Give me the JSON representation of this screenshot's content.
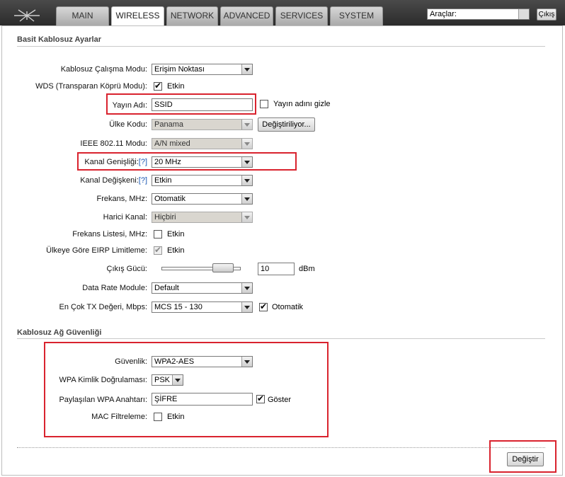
{
  "nav": {
    "tabs": [
      {
        "label": "MAIN"
      },
      {
        "label": "WIRELESS"
      },
      {
        "label": "NETWORK"
      },
      {
        "label": "ADVANCED"
      },
      {
        "label": "SERVICES"
      },
      {
        "label": "SYSTEM"
      }
    ],
    "active_tab": "WIRELESS",
    "tools_select": "Araçlar:",
    "logout_label": "Çıkış"
  },
  "basic": {
    "title": "Basit Kablosuz Ayarlar",
    "mode_label": "Kablosuz Çalışma Modu:",
    "mode_value": "Erişim Noktası",
    "wds_label": "WDS (Transparan Köprü Modu):",
    "wds_enabled": true,
    "wds_text": "Etkin",
    "ssid_label": "Yayın Adı:",
    "ssid_value": "SSID",
    "hide_ssid_text": "Yayın adını gizle",
    "hide_ssid": false,
    "country_label": "Ülke Kodu:",
    "country_value": "Panama",
    "country_button": "Değiştiriliyor...",
    "ieee_label": "IEEE 802.11 Modu:",
    "ieee_value": "A/N mixed",
    "width_label": "Kanal Genişliği:",
    "width_help": "[?]",
    "width_value": "20 MHz",
    "shift_label": "Kanal Değişkeni:",
    "shift_help": "[?]",
    "shift_value": "Etkin",
    "freq_label": "Frekans, MHz:",
    "freq_value": "Otomatik",
    "ext_label": "Harici Kanal:",
    "ext_value": "Hiçbiri",
    "freqlist_label": "Frekans Listesi, MHz:",
    "freqlist_text": "Etkin",
    "freqlist_enabled": false,
    "eirp_label": "Ülkeye Göre EIRP Limitleme:",
    "eirp_text": "Etkin",
    "eirp_enabled": true,
    "power_label": "Çıkış Gücü:",
    "power_value": "10",
    "power_unit": "dBm",
    "datarate_label": "Data Rate Module:",
    "datarate_value": "Default",
    "maxtx_label": "En Çok TX Değeri, Mbps:",
    "maxtx_value": "MCS 15 - 130",
    "maxtx_auto_text": "Otomatik",
    "maxtx_auto": true
  },
  "security": {
    "title": "Kablosuz Ağ Güvenliği",
    "security_label": "Güvenlik:",
    "security_value": "WPA2-AES",
    "auth_label": "WPA Kimlik Doğrulaması:",
    "auth_value": "PSK",
    "key_label": "Paylaşılan WPA Anahtarı:",
    "key_value": "ŞİFRE",
    "show_text": "Göster",
    "show_enabled": true,
    "mac_label": "MAC Filtreleme:",
    "mac_text": "Etkin",
    "mac_enabled": false
  },
  "footer": {
    "apply_label": "Değiştir"
  },
  "colors": {
    "highlight": "#d9232e",
    "help_link": "#1a57b3"
  }
}
